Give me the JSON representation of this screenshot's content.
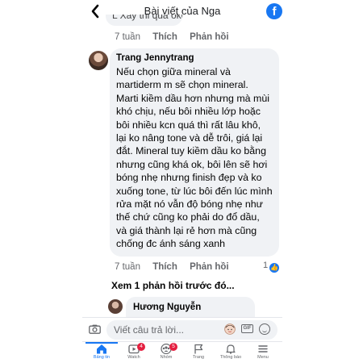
{
  "header": {
    "title": "Bài viết của Nga",
    "back_icon": "chevron-left-icon",
    "brand_icon": "facebook-icon",
    "accent": "#1877f2"
  },
  "previous_comment": {
    "partial_text": "L Xay thi qua oko :",
    "time": "7 tuần",
    "like_label": "Thích",
    "reply_label": "Phản hồi"
  },
  "comment": {
    "author": "Trang Jennytrang",
    "text": "Nếu chọn giữa mineral và martiderm m sẽ chọn mineral. Marti kiềm dầu hơn nhưng mà mùi khó chịu, nếu bôi nhiều lớp hoặc bôi nhiều kcn quá thì rất lâu khô, lại ko nâng tone và dễ trôi, giá lại đắt. Mineral tuy kiềm dầu ko bằng nhưng cũng khá ok, bôi lên sẽ hơi bóng nhẹ nhưng finish đẹp và ko xuống tone, từ lúc bôi đến lúc mình rửa mặt nó vẫn độ bóng nhẹ như thế chứ cũng ko phải do đổ dầu, và giá thành lại rẻ hơn mà cũng chống đc ánh sáng xanh",
    "time": "7 tuần",
    "like_label": "Thích",
    "reply_label": "Phản hồi",
    "reaction_count": "1",
    "reaction_icon": "like-icon"
  },
  "view_previous_replies": "Xem 1 phản hồi trước đó...",
  "reply": {
    "author": "Hương Nguyễn"
  },
  "composer": {
    "placeholder": "Viết câu trả lời..."
  },
  "nav": {
    "items": [
      {
        "label": "Bảng tin",
        "icon": "home-icon",
        "badge": ""
      },
      {
        "label": "Watch",
        "icon": "watch-icon",
        "badge": "4"
      },
      {
        "label": "Nhóm",
        "icon": "groups-icon",
        "badge": "5"
      },
      {
        "label": "Trang",
        "icon": "flag-icon",
        "badge": ""
      },
      {
        "label": "Thông báo",
        "icon": "bell-icon",
        "badge": ""
      },
      {
        "label": "Menu",
        "icon": "menu-icon",
        "badge": ""
      }
    ],
    "active_color": "#1877f2",
    "badge_color": "#e41e3f"
  }
}
